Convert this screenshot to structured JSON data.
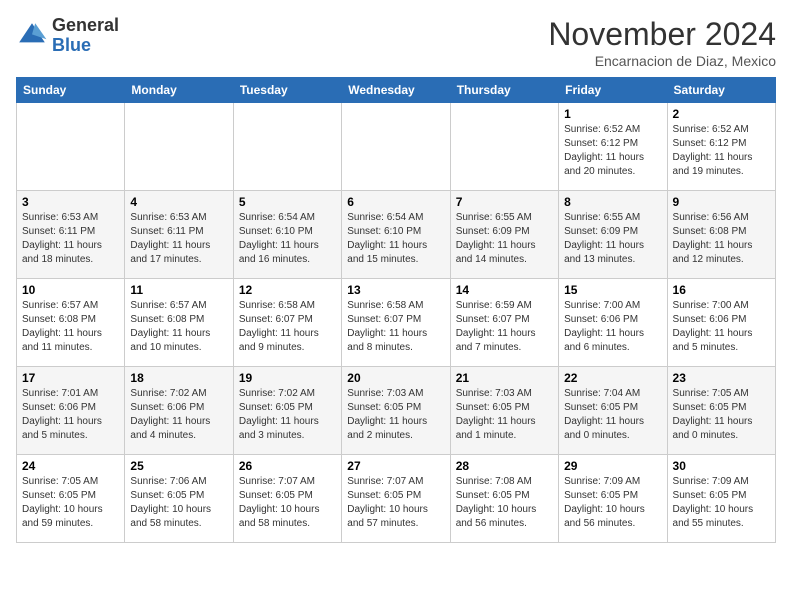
{
  "header": {
    "logo": {
      "line1": "General",
      "line2": "Blue"
    },
    "title": "November 2024",
    "location": "Encarnacion de Diaz, Mexico"
  },
  "weekdays": [
    "Sunday",
    "Monday",
    "Tuesday",
    "Wednesday",
    "Thursday",
    "Friday",
    "Saturday"
  ],
  "weeks": [
    [
      {
        "day": "",
        "info": ""
      },
      {
        "day": "",
        "info": ""
      },
      {
        "day": "",
        "info": ""
      },
      {
        "day": "",
        "info": ""
      },
      {
        "day": "",
        "info": ""
      },
      {
        "day": "1",
        "info": "Sunrise: 6:52 AM\nSunset: 6:12 PM\nDaylight: 11 hours and 20 minutes."
      },
      {
        "day": "2",
        "info": "Sunrise: 6:52 AM\nSunset: 6:12 PM\nDaylight: 11 hours and 19 minutes."
      }
    ],
    [
      {
        "day": "3",
        "info": "Sunrise: 6:53 AM\nSunset: 6:11 PM\nDaylight: 11 hours and 18 minutes."
      },
      {
        "day": "4",
        "info": "Sunrise: 6:53 AM\nSunset: 6:11 PM\nDaylight: 11 hours and 17 minutes."
      },
      {
        "day": "5",
        "info": "Sunrise: 6:54 AM\nSunset: 6:10 PM\nDaylight: 11 hours and 16 minutes."
      },
      {
        "day": "6",
        "info": "Sunrise: 6:54 AM\nSunset: 6:10 PM\nDaylight: 11 hours and 15 minutes."
      },
      {
        "day": "7",
        "info": "Sunrise: 6:55 AM\nSunset: 6:09 PM\nDaylight: 11 hours and 14 minutes."
      },
      {
        "day": "8",
        "info": "Sunrise: 6:55 AM\nSunset: 6:09 PM\nDaylight: 11 hours and 13 minutes."
      },
      {
        "day": "9",
        "info": "Sunrise: 6:56 AM\nSunset: 6:08 PM\nDaylight: 11 hours and 12 minutes."
      }
    ],
    [
      {
        "day": "10",
        "info": "Sunrise: 6:57 AM\nSunset: 6:08 PM\nDaylight: 11 hours and 11 minutes."
      },
      {
        "day": "11",
        "info": "Sunrise: 6:57 AM\nSunset: 6:08 PM\nDaylight: 11 hours and 10 minutes."
      },
      {
        "day": "12",
        "info": "Sunrise: 6:58 AM\nSunset: 6:07 PM\nDaylight: 11 hours and 9 minutes."
      },
      {
        "day": "13",
        "info": "Sunrise: 6:58 AM\nSunset: 6:07 PM\nDaylight: 11 hours and 8 minutes."
      },
      {
        "day": "14",
        "info": "Sunrise: 6:59 AM\nSunset: 6:07 PM\nDaylight: 11 hours and 7 minutes."
      },
      {
        "day": "15",
        "info": "Sunrise: 7:00 AM\nSunset: 6:06 PM\nDaylight: 11 hours and 6 minutes."
      },
      {
        "day": "16",
        "info": "Sunrise: 7:00 AM\nSunset: 6:06 PM\nDaylight: 11 hours and 5 minutes."
      }
    ],
    [
      {
        "day": "17",
        "info": "Sunrise: 7:01 AM\nSunset: 6:06 PM\nDaylight: 11 hours and 5 minutes."
      },
      {
        "day": "18",
        "info": "Sunrise: 7:02 AM\nSunset: 6:06 PM\nDaylight: 11 hours and 4 minutes."
      },
      {
        "day": "19",
        "info": "Sunrise: 7:02 AM\nSunset: 6:05 PM\nDaylight: 11 hours and 3 minutes."
      },
      {
        "day": "20",
        "info": "Sunrise: 7:03 AM\nSunset: 6:05 PM\nDaylight: 11 hours and 2 minutes."
      },
      {
        "day": "21",
        "info": "Sunrise: 7:03 AM\nSunset: 6:05 PM\nDaylight: 11 hours and 1 minute."
      },
      {
        "day": "22",
        "info": "Sunrise: 7:04 AM\nSunset: 6:05 PM\nDaylight: 11 hours and 0 minutes."
      },
      {
        "day": "23",
        "info": "Sunrise: 7:05 AM\nSunset: 6:05 PM\nDaylight: 11 hours and 0 minutes."
      }
    ],
    [
      {
        "day": "24",
        "info": "Sunrise: 7:05 AM\nSunset: 6:05 PM\nDaylight: 10 hours and 59 minutes."
      },
      {
        "day": "25",
        "info": "Sunrise: 7:06 AM\nSunset: 6:05 PM\nDaylight: 10 hours and 58 minutes."
      },
      {
        "day": "26",
        "info": "Sunrise: 7:07 AM\nSunset: 6:05 PM\nDaylight: 10 hours and 58 minutes."
      },
      {
        "day": "27",
        "info": "Sunrise: 7:07 AM\nSunset: 6:05 PM\nDaylight: 10 hours and 57 minutes."
      },
      {
        "day": "28",
        "info": "Sunrise: 7:08 AM\nSunset: 6:05 PM\nDaylight: 10 hours and 56 minutes."
      },
      {
        "day": "29",
        "info": "Sunrise: 7:09 AM\nSunset: 6:05 PM\nDaylight: 10 hours and 56 minutes."
      },
      {
        "day": "30",
        "info": "Sunrise: 7:09 AM\nSunset: 6:05 PM\nDaylight: 10 hours and 55 minutes."
      }
    ]
  ]
}
